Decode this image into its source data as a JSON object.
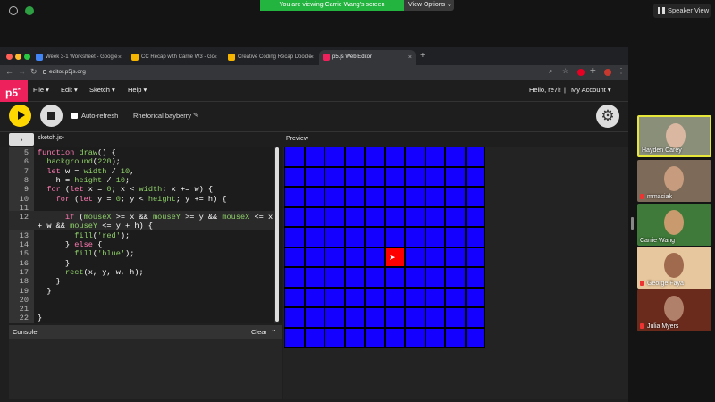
{
  "zoom": {
    "share_banner": "You are viewing Carrie Wang's screen",
    "view_options": "View Options ⌄",
    "speaker_view": "Speaker View"
  },
  "browser": {
    "tabs": [
      {
        "title": "Week 3-1 Worksheet - Google",
        "color": "#4285f4"
      },
      {
        "title": "CC Recap with Carrie W3 - Go",
        "color": "#f4b400"
      },
      {
        "title": "Creative Coding Recap Doodle",
        "color": "#f4b400"
      },
      {
        "title": "p5.js Web Editor",
        "color": "#ed225d"
      }
    ],
    "url": "editor.p5js.org"
  },
  "p5": {
    "logo": "p5",
    "logo_sup": "*",
    "menus": [
      "File ▾",
      "Edit ▾",
      "Sketch ▾",
      "Help ▾"
    ],
    "user_greeting": "Hello, re7l!",
    "separator": "|",
    "account": "My Account ▾",
    "auto_refresh": "Auto-refresh",
    "sketch_name": "Rhetorical bayberry",
    "pencil": "✎",
    "filename": "sketch.js•",
    "preview": "Preview",
    "expand": "›",
    "console": "Console",
    "clear": "Clear",
    "console_chevron": "⌄",
    "settings": "⚙"
  },
  "code": {
    "line_numbers": [
      "5",
      "6",
      "7",
      "8",
      "9",
      "10",
      "11",
      "12",
      "",
      "13",
      "14",
      "15",
      "16",
      "17",
      "18",
      "19",
      "20",
      "21",
      "22"
    ],
    "lines": [
      "function draw() {",
      "  background(220);",
      "  let w = width / 10,",
      "    h = height / 10;",
      "  for (let x = 0; x < width; x += w) {",
      "    for (let y = 0; y < height; y += h) {",
      "",
      "      if (mouseX >= x && mouseY >= y && mouseX <= x",
      "+ w && mouseY <= y + h) {",
      "        fill('red');",
      "      } else {",
      "        fill('blue');",
      "      }",
      "      rect(x, y, w, h);",
      "    }",
      "  }",
      "",
      "",
      "}"
    ]
  },
  "grid": {
    "columns": 10,
    "rows": 10,
    "fill_color": "#1400ff",
    "hover_color": "#ff0000",
    "hover_cell": [
      5,
      5
    ]
  },
  "participants": [
    {
      "name": "Hayden Carey",
      "muted": false,
      "bg": "#8a8f7a",
      "skin": "#d9b7a0",
      "active": true
    },
    {
      "name": "mmaciak",
      "muted": true,
      "bg": "#7d6a58",
      "skin": "#c79b7d",
      "active": false
    },
    {
      "name": "Carrie Wang",
      "muted": false,
      "bg": "#3f7a3a",
      "skin": "#c99a6e",
      "active": false
    },
    {
      "name": "George Faya",
      "muted": true,
      "bg": "#e7c89e",
      "skin": "#a06a4f",
      "active": false
    },
    {
      "name": "Julia Myers",
      "muted": true,
      "bg": "#6a2a1c",
      "skin": "#b0806a",
      "active": false
    }
  ]
}
